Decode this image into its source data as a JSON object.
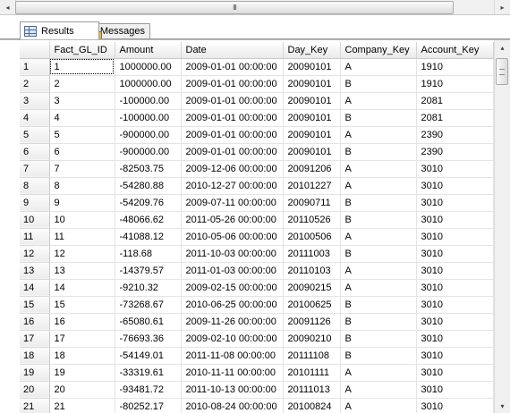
{
  "scrollbar": {
    "left_arrow": "◂",
    "right_arrow": "▸",
    "thumb_grip": "III",
    "up_arrow": "▴",
    "down_arrow": "▾"
  },
  "tabs": [
    {
      "label": "Results",
      "icon": "grid-icon",
      "active": true
    },
    {
      "label": "Messages",
      "icon": "messages-icon",
      "active": false
    }
  ],
  "grid": {
    "columns": [
      "Fact_GL_ID",
      "Amount",
      "Date",
      "Day_Key",
      "Company_Key",
      "Account_Key"
    ],
    "rows": [
      {
        "rn": "1",
        "cells": [
          "1",
          "1000000.00",
          "2009-01-01 00:00:00",
          "20090101",
          "A",
          "1910"
        ]
      },
      {
        "rn": "2",
        "cells": [
          "2",
          "1000000.00",
          "2009-01-01 00:00:00",
          "20090101",
          "B",
          "1910"
        ]
      },
      {
        "rn": "3",
        "cells": [
          "3",
          "-100000.00",
          "2009-01-01 00:00:00",
          "20090101",
          "A",
          "2081"
        ]
      },
      {
        "rn": "4",
        "cells": [
          "4",
          "-100000.00",
          "2009-01-01 00:00:00",
          "20090101",
          "B",
          "2081"
        ]
      },
      {
        "rn": "5",
        "cells": [
          "5",
          "-900000.00",
          "2009-01-01 00:00:00",
          "20090101",
          "A",
          "2390"
        ]
      },
      {
        "rn": "6",
        "cells": [
          "6",
          "-900000.00",
          "2009-01-01 00:00:00",
          "20090101",
          "B",
          "2390"
        ]
      },
      {
        "rn": "7",
        "cells": [
          "7",
          "-82503.75",
          "2009-12-06 00:00:00",
          "20091206",
          "A",
          "3010"
        ]
      },
      {
        "rn": "8",
        "cells": [
          "8",
          "-54280.88",
          "2010-12-27 00:00:00",
          "20101227",
          "A",
          "3010"
        ]
      },
      {
        "rn": "9",
        "cells": [
          "9",
          "-54209.76",
          "2009-07-11 00:00:00",
          "20090711",
          "B",
          "3010"
        ]
      },
      {
        "rn": "10",
        "cells": [
          "10",
          "-48066.62",
          "2011-05-26 00:00:00",
          "20110526",
          "B",
          "3010"
        ]
      },
      {
        "rn": "11",
        "cells": [
          "11",
          "-41088.12",
          "2010-05-06 00:00:00",
          "20100506",
          "A",
          "3010"
        ]
      },
      {
        "rn": "12",
        "cells": [
          "12",
          "-118.68",
          "2011-10-03 00:00:00",
          "20111003",
          "B",
          "3010"
        ]
      },
      {
        "rn": "13",
        "cells": [
          "13",
          "-14379.57",
          "2011-01-03 00:00:00",
          "20110103",
          "A",
          "3010"
        ]
      },
      {
        "rn": "14",
        "cells": [
          "14",
          "-9210.32",
          "2009-02-15 00:00:00",
          "20090215",
          "A",
          "3010"
        ]
      },
      {
        "rn": "15",
        "cells": [
          "15",
          "-73268.67",
          "2010-06-25 00:00:00",
          "20100625",
          "B",
          "3010"
        ]
      },
      {
        "rn": "16",
        "cells": [
          "16",
          "-65080.61",
          "2009-11-26 00:00:00",
          "20091126",
          "B",
          "3010"
        ]
      },
      {
        "rn": "17",
        "cells": [
          "17",
          "-76693.36",
          "2009-02-10 00:00:00",
          "20090210",
          "B",
          "3010"
        ]
      },
      {
        "rn": "18",
        "cells": [
          "18",
          "-54149.01",
          "2011-11-08 00:00:00",
          "20111108",
          "B",
          "3010"
        ]
      },
      {
        "rn": "19",
        "cells": [
          "19",
          "-33319.61",
          "2010-11-11 00:00:00",
          "20101111",
          "A",
          "3010"
        ]
      },
      {
        "rn": "20",
        "cells": [
          "20",
          "-93481.72",
          "2011-10-13 00:00:00",
          "20111013",
          "A",
          "3010"
        ]
      },
      {
        "rn": "21",
        "cells": [
          "21",
          "-80252.17",
          "2010-08-24 00:00:00",
          "20100824",
          "A",
          "3010"
        ]
      }
    ]
  }
}
